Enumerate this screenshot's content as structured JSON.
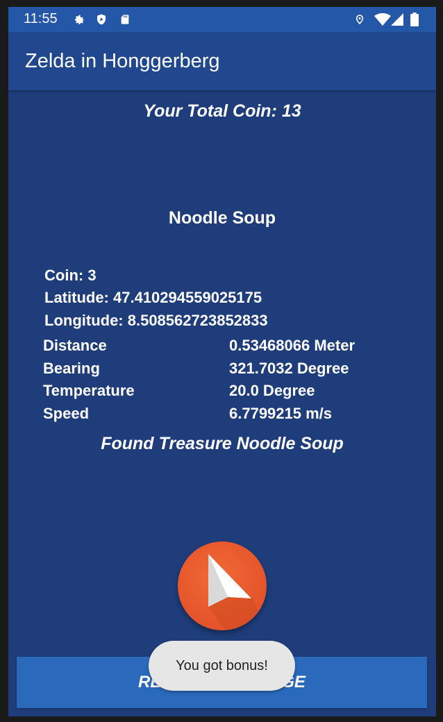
{
  "status_bar": {
    "time": "11:55",
    "icons": [
      "gear-icon",
      "shield-icon",
      "sd-card-icon",
      "location-icon",
      "wifi-icon",
      "signal-icon",
      "battery-icon"
    ]
  },
  "app": {
    "title": "Zelda in Honggerberg"
  },
  "main": {
    "total_coin": "Your Total Coin:  13",
    "treasure_name": "Noodle Soup",
    "coin": "Coin:  3",
    "latitude": "Latitude:  47.410294559025175",
    "longitude": "Longitude:  8.508562723852833",
    "rows": [
      {
        "label": "Distance",
        "value": "0.53468066 Meter"
      },
      {
        "label": "Bearing",
        "value": "321.7032 Degree"
      },
      {
        "label": "Temperature",
        "value": "20.0 Degree"
      },
      {
        "label": "Speed",
        "value": "6.7799215 m/s"
      }
    ],
    "found": "Found Treasure  Noodle Soup"
  },
  "buttons": {
    "return_label": "RETURN MAIN PAGE",
    "compass_icon": "navigation-arrow-icon"
  },
  "toast": {
    "message": "You got bonus!"
  },
  "colors": {
    "background": "#1f3d7a",
    "status_bar": "#2457a8",
    "app_bar": "#21488e",
    "button": "#2a69bb",
    "fab": "#e4532a",
    "toast": "#e6e6e6"
  }
}
